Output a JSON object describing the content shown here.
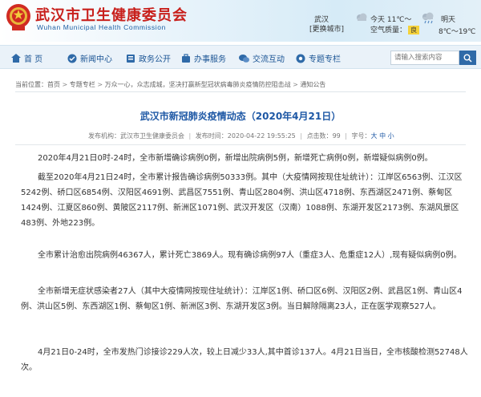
{
  "header": {
    "title": "武汉市卫生健康委员会",
    "subtitle": "Wuhan Municipal Health Commission",
    "city": "武汉",
    "district": "[更换城市]",
    "today_label": "今天 11℃～",
    "air_quality_label": "空气质量：",
    "air_quality_value": "良",
    "tomorrow_label": "明天",
    "tomorrow_temp": "8℃～19℃"
  },
  "nav": {
    "items": [
      {
        "label": "首 页",
        "icon": "home-icon"
      },
      {
        "label": "新闻中心",
        "icon": "news-icon"
      },
      {
        "label": "政务公开",
        "icon": "government-icon"
      },
      {
        "label": "办事服务",
        "icon": "service-icon"
      },
      {
        "label": "交流互动",
        "icon": "interaction-icon"
      },
      {
        "label": "专题专栏",
        "icon": "topic-icon"
      }
    ],
    "search_placeholder": "请输入搜索内容"
  },
  "breadcrumb": {
    "items": [
      "当前位置：首页",
      "专题专栏",
      "万众一心，众志成城，坚决打赢新型冠状病毒肺炎疫情防控阻击战",
      "通知公告"
    ],
    "separator": ">"
  },
  "article": {
    "title": "武汉市新冠肺炎疫情动态（2020年4月21日）",
    "source_label": "发布机构：",
    "source": "武汉市卫生健康委员会",
    "publish_label": "发布时间：",
    "publish_time": "2020-04-22 19:55:25",
    "views_label": "点击数：",
    "views": "99",
    "font_label": "字号：",
    "font_large": "大",
    "font_medium": "中",
    "font_small": "小",
    "paragraphs": [
      "2020年4月21日0时-24时，全市新增确诊病例0例，新增出院病例5例，新增死亡病例0例，新增疑似病例0例。",
      "截至2020年4月21日24时，全市累计报告确诊病例50333例。其中（大疫情网按现住址统计）：江岸区6563例、江汉区5242例、硚口区6854例、汉阳区4691例、武昌区7551例、青山区2804例、洪山区4718例、东西湖区2471例、蔡甸区1424例、江夏区860例、黄陂区2117例、新洲区1071例、武汉开发区（汉南）1088例、东湖开发区2173例、东湖风景区483例、外地223例。",
      "全市累计治愈出院病例46367人，累计死亡3869人。现有确诊病例97人（重症3人、危重症12人）,现有疑似病例0例。",
      "全市新增无症状感染者27人（其中大疫情网按现住址统计）：江岸区1例、硚口区6例、汉阳区2例、武昌区1例、青山区4例、洪山区5例、东西湖区1例、蔡甸区1例、新洲区3例、东湖开发区3例。当日解除隔离23人，正在医学观察527人。",
      "4月21日0-24时，全市发热门诊接诊229人次，较上日减少33人,其中首诊137人。4月21日当日，全市核酸检测52748人次。"
    ]
  },
  "colors": {
    "title_red": "#c8201c",
    "brand_blue": "#1e58a5",
    "nav_bg": "#eaf2f9"
  }
}
